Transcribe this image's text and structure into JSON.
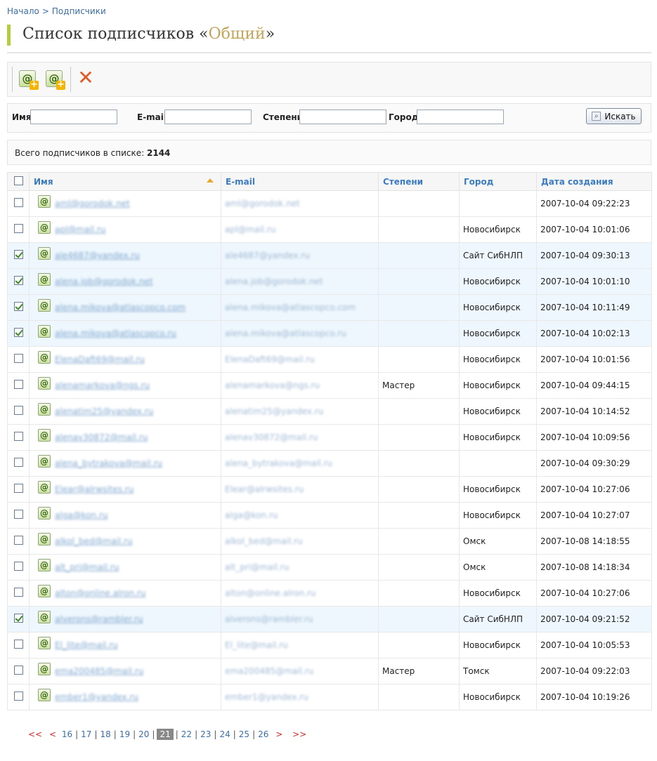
{
  "breadcrumb": {
    "home": "Начало",
    "separator": ">",
    "current": "Подписчики"
  },
  "title": {
    "prefix": "Список подписчиков «",
    "list_name": "Общий",
    "suffix": "»"
  },
  "toolbar": {
    "buttons": [
      {
        "name": "add-subscriber",
        "icon": "at-plus-icon"
      },
      {
        "name": "add-group",
        "icon": "group-plus-icon"
      },
      {
        "name": "delete",
        "icon": "red-x-icon"
      }
    ]
  },
  "filter": {
    "name_label": "Имя",
    "name_value": "",
    "email_label": "E-mail",
    "email_value": "",
    "degree_label": "Степени",
    "degree_value": "",
    "city_label": "Город",
    "city_value": "",
    "search_label": "Искать"
  },
  "summary": {
    "label": "Всего подписчиков в списке:",
    "count": "2144"
  },
  "table": {
    "headers": {
      "name": "Имя",
      "email": "E-mail",
      "degree": "Степени",
      "city": "Город",
      "created": "Дата создания"
    },
    "rows": [
      {
        "checked": false,
        "name": "aml@gorodok.net",
        "email": "aml@gorodok.net",
        "degree": "",
        "city": "",
        "created": "2007-10-04 09:22:23"
      },
      {
        "checked": false,
        "name": "apl@mail.ru",
        "email": "apl@mail.ru",
        "degree": "",
        "city": "Новосибирск",
        "created": "2007-10-04 10:01:06"
      },
      {
        "checked": true,
        "name": "ale4687@yandex.ru",
        "email": "ale4687@yandex.ru",
        "degree": "",
        "city": "Сайт СибНЛП",
        "created": "2007-10-04 09:30:13"
      },
      {
        "checked": true,
        "name": "alena.job@gorodok.net",
        "email": "alena.job@gorodok.net",
        "degree": "",
        "city": "Новосибирск",
        "created": "2007-10-04 10:01:10"
      },
      {
        "checked": true,
        "name": "alena.mikova@atlascopco.com",
        "email": "alena.mikova@atlascopco.com",
        "degree": "",
        "city": "Новосибирск",
        "created": "2007-10-04 10:11:49"
      },
      {
        "checked": true,
        "name": "alena.mikova@atlascopco.ru",
        "email": "alena.mikova@atlascopco.ru",
        "degree": "",
        "city": "Новосибирск",
        "created": "2007-10-04 10:02:13"
      },
      {
        "checked": false,
        "name": "ElenaDaft69@mail.ru",
        "email": "ElenaDaft69@mail.ru",
        "degree": "",
        "city": "Новосибирск",
        "created": "2007-10-04 10:01:56"
      },
      {
        "checked": false,
        "name": "alenamarkova@ngs.ru",
        "email": "alenamarkova@ngs.ru",
        "degree": "Мастер",
        "city": "Новосибирск",
        "created": "2007-10-04 09:44:15"
      },
      {
        "checked": false,
        "name": "alenatim25@yandex.ru",
        "email": "alenatim25@yandex.ru",
        "degree": "",
        "city": "Новосибирск",
        "created": "2007-10-04 10:14:52"
      },
      {
        "checked": false,
        "name": "alenav30872@mail.ru",
        "email": "alenav30872@mail.ru",
        "degree": "",
        "city": "Новосибирск",
        "created": "2007-10-04 10:09:56"
      },
      {
        "checked": false,
        "name": "alena_bytrakova@mail.ru",
        "email": "alena_bytrakova@mail.ru",
        "degree": "",
        "city": "",
        "created": "2007-10-04 09:30:29"
      },
      {
        "checked": false,
        "name": "Elear@alrwsites.ru",
        "email": "Elear@alrwsites.ru",
        "degree": "",
        "city": "Новосибирск",
        "created": "2007-10-04 10:27:06"
      },
      {
        "checked": false,
        "name": "alga@kon.ru",
        "email": "alga@kon.ru",
        "degree": "",
        "city": "Новосибирск",
        "created": "2007-10-04 10:27:07"
      },
      {
        "checked": false,
        "name": "alkol_bed@mail.ru",
        "email": "alkol_bed@mail.ru",
        "degree": "",
        "city": "Омск",
        "created": "2007-10-08 14:18:55"
      },
      {
        "checked": false,
        "name": "alt_pri@mail.ru",
        "email": "alt_pri@mail.ru",
        "degree": "",
        "city": "Омск",
        "created": "2007-10-08 14:18:34"
      },
      {
        "checked": false,
        "name": "alton@online.alron.ru",
        "email": "alton@online.alron.ru",
        "degree": "",
        "city": "Новосибирск",
        "created": "2007-10-04 10:27:06"
      },
      {
        "checked": true,
        "name": "alverons@rambler.ru",
        "email": "alverons@rambler.ru",
        "degree": "",
        "city": "Сайт СибНЛП",
        "created": "2007-10-04 09:21:52"
      },
      {
        "checked": false,
        "name": "El_lite@mail.ru",
        "email": "El_lite@mail.ru",
        "degree": "",
        "city": "Новосибирск",
        "created": "2007-10-04 10:05:53"
      },
      {
        "checked": false,
        "name": "ema200485@mail.ru",
        "email": "ema200485@mail.ru",
        "degree": "Мастер",
        "city": "Томск",
        "created": "2007-10-04 09:22:03"
      },
      {
        "checked": false,
        "name": "ember1@yandex.ru",
        "email": "ember1@yandex.ru",
        "degree": "",
        "city": "Новосибирск",
        "created": "2007-10-04 10:19:26"
      }
    ]
  },
  "pager": {
    "first": "<<",
    "prev": "<",
    "pages": [
      "16",
      "17",
      "18",
      "19",
      "20",
      "21",
      "22",
      "23",
      "24",
      "25",
      "26"
    ],
    "current": "21",
    "next": ">",
    "last": ">>"
  }
}
